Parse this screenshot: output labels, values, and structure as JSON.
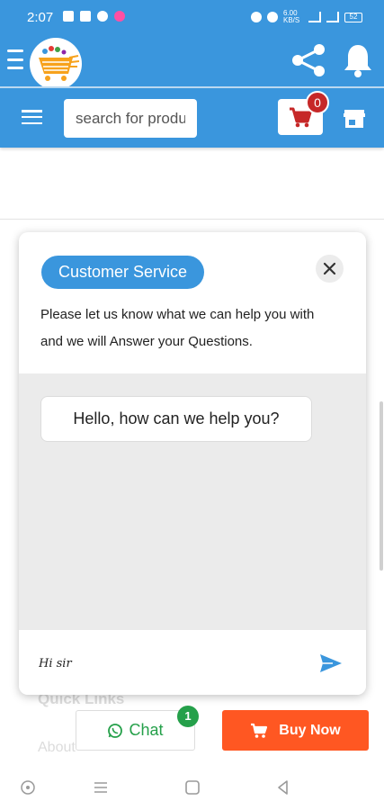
{
  "status_bar": {
    "time": "2:07",
    "network_speed": "6.00 KB/S",
    "battery": "52"
  },
  "header": {
    "logo_alt": "store logo",
    "cart_count": "0"
  },
  "search": {
    "placeholder": "search for products"
  },
  "page": {
    "quick_links": "Quick Links",
    "about": "About"
  },
  "chat_widget": {
    "tag": "Customer Service",
    "intro": "Please let us know what we can help you with and we will Answer your Questions.",
    "greeting": "Hello, how can we help you?",
    "input_value": "Hi sir"
  },
  "actions": {
    "chat_label": "Chat",
    "chat_badge": "1",
    "buy_label": "Buy Now"
  },
  "colors": {
    "primary": "#3a96dd",
    "buy": "#ff5722",
    "whatsapp": "#25a04a",
    "cart_badge": "#c62828"
  }
}
